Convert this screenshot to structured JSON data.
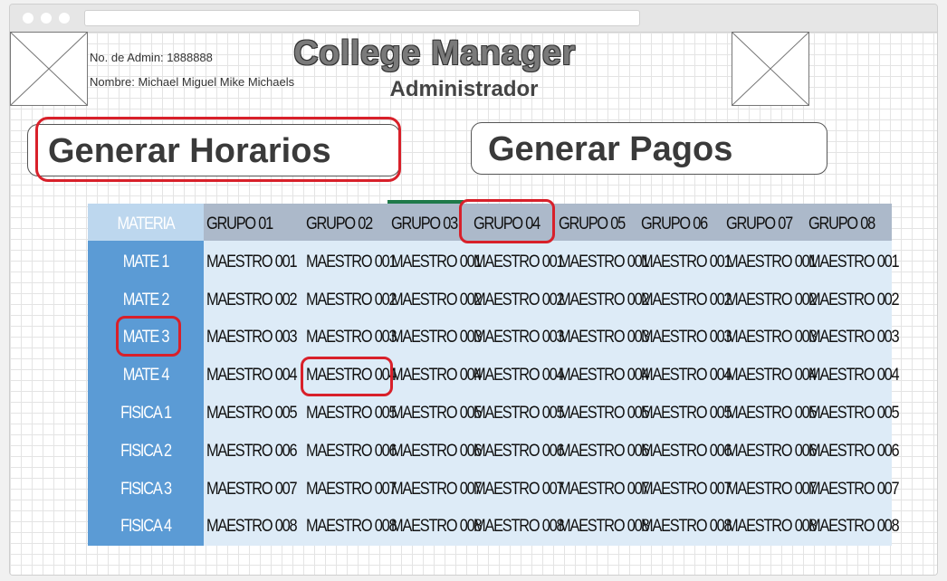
{
  "app": {
    "title": "College Manager",
    "subtitle": "Administrador",
    "admin_number": "No. de Admin: 1888888",
    "admin_name": "Nombre: Michael Miguel Mike Michaels"
  },
  "actions": {
    "generate_schedules": "Generar Horarios",
    "generate_payments": "Generar Pagos"
  },
  "schedule": {
    "subject_header": "MATERIA",
    "groups": [
      "GRUPO 01",
      "GRUPO 02",
      "GRUPO 03",
      "GRUPO 04",
      "GRUPO 05",
      "GRUPO 06",
      "GRUPO 07",
      "GRUPO 08"
    ],
    "rows": [
      {
        "subject": "MATE 1",
        "cells": [
          "MAESTRO 001",
          "MAESTRO 001",
          "MAESTRO 001",
          "MAESTRO 001",
          "MAESTRO 001",
          "MAESTRO 001",
          "MAESTRO 001",
          "MAESTRO 001"
        ]
      },
      {
        "subject": "MATE 2",
        "cells": [
          "MAESTRO 002",
          "MAESTRO 002",
          "MAESTRO 002",
          "MAESTRO 002",
          "MAESTRO 002",
          "MAESTRO 002",
          "MAESTRO 002",
          "MAESTRO 002"
        ]
      },
      {
        "subject": "MATE 3",
        "cells": [
          "MAESTRO 003",
          "MAESTRO 003",
          "MAESTRO 003",
          "MAESTRO 003",
          "MAESTRO 003",
          "MAESTRO 003",
          "MAESTRO 003",
          "MAESTRO 003"
        ]
      },
      {
        "subject": "MATE 4",
        "cells": [
          "MAESTRO 004",
          "MAESTRO 004",
          "MAESTRO 004",
          "MAESTRO 004",
          "MAESTRO 004",
          "MAESTRO 004",
          "MAESTRO 004",
          "MAESTRO 004"
        ]
      },
      {
        "subject": "FISICA 1",
        "cells": [
          "MAESTRO 005",
          "MAESTRO 005",
          "MAESTRO 005",
          "MAESTRO 005",
          "MAESTRO 005",
          "MAESTRO 005",
          "MAESTRO 005",
          "MAESTRO 005"
        ]
      },
      {
        "subject": "FISICA 2",
        "cells": [
          "MAESTRO 006",
          "MAESTRO 006",
          "MAESTRO 006",
          "MAESTRO 006",
          "MAESTRO 006",
          "MAESTRO 006",
          "MAESTRO 006",
          "MAESTRO 006"
        ]
      },
      {
        "subject": "FISICA 3",
        "cells": [
          "MAESTRO 007",
          "MAESTRO 007",
          "MAESTRO 007",
          "MAESTRO 007",
          "MAESTRO 007",
          "MAESTRO 007",
          "MAESTRO 007",
          "MAESTRO 007"
        ]
      },
      {
        "subject": "FISICA 4",
        "cells": [
          "MAESTRO 008",
          "MAESTRO 008",
          "MAESTRO 008",
          "MAESTRO 008",
          "MAESTRO 008",
          "MAESTRO 008",
          "MAESTRO 008",
          "MAESTRO 008"
        ]
      }
    ]
  },
  "colors": {
    "highlight": "#d8202a",
    "subject_column": "#5b9bd5",
    "header_row": "#acb9ca",
    "body_cells": "#ddebf7"
  },
  "icons": {
    "left_placeholder": "image-placeholder-icon",
    "right_placeholder": "image-placeholder-icon"
  }
}
